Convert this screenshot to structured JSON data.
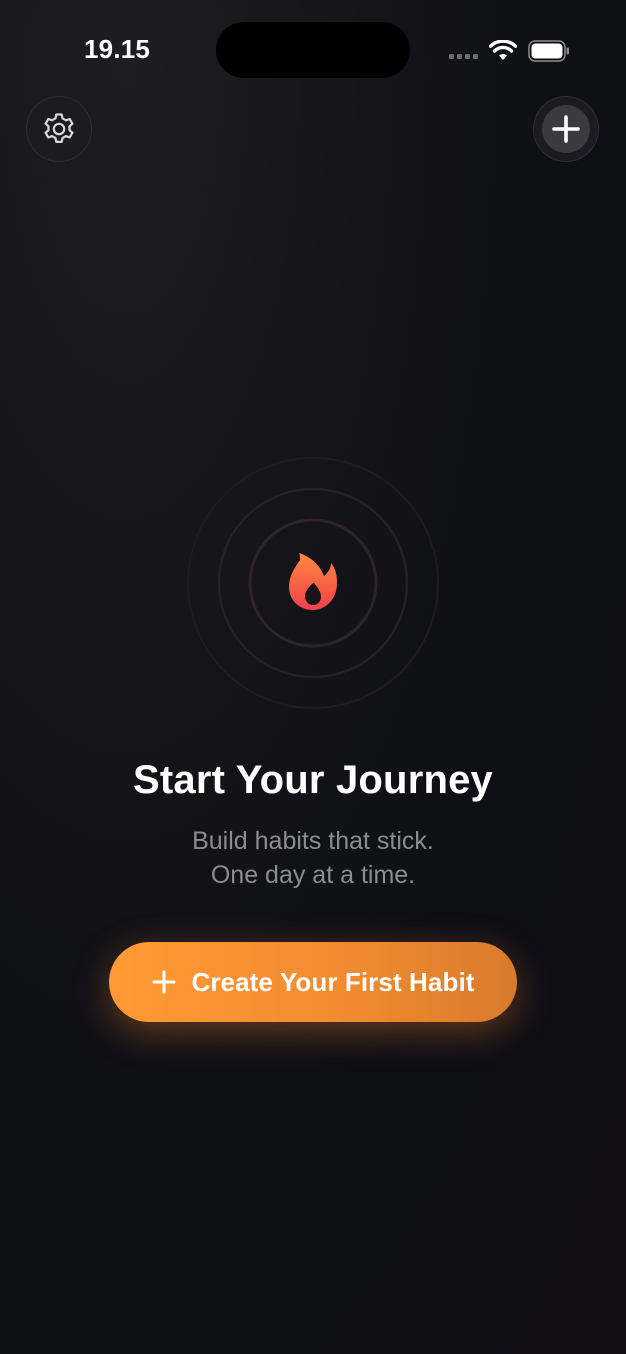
{
  "status_bar": {
    "time": "19.15"
  },
  "header": {
    "settings_icon": "gear-icon",
    "add_icon": "plus-icon"
  },
  "hero": {
    "icon": "flame-icon",
    "colors": {
      "flame_top": "#ff8a3c",
      "flame_bottom": "#f2404e",
      "ring": "#2a2226"
    }
  },
  "empty_state": {
    "title": "Start Your Journey",
    "subtitle_line1": "Build habits that stick.",
    "subtitle_line2": "One day at a time.",
    "cta_label": "Create Your First Habit",
    "cta_icon": "plus-icon",
    "accent": "#f7922f"
  }
}
